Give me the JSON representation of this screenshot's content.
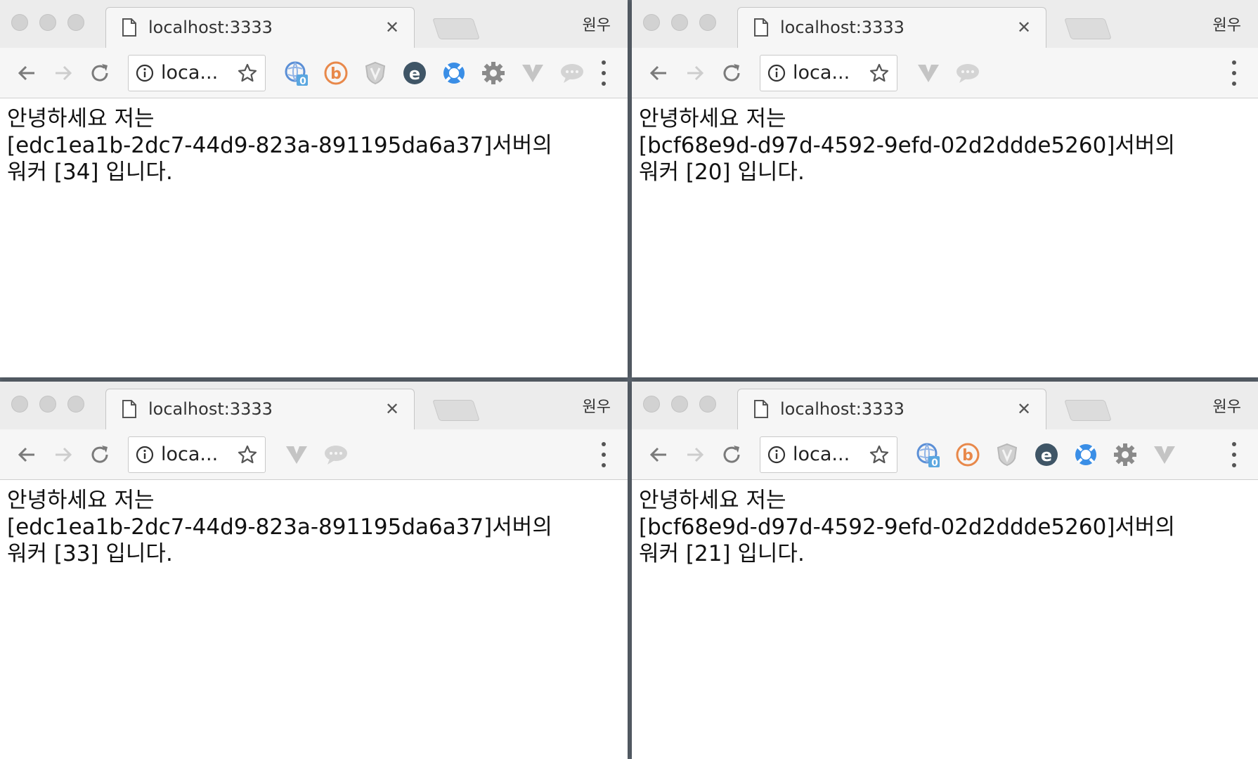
{
  "windows": [
    {
      "tab_title": "localhost:3333",
      "profile": "원우",
      "address": "loca...",
      "extensions": [
        "globe-badge",
        "b-circle",
        "shield",
        "e-circle",
        "lifebuoy",
        "gear",
        "v-logo",
        "chat-bubble"
      ],
      "badge": "0",
      "lines": [
        "안녕하세요 저는",
        "[edc1ea1b-2dc7-44d9-823a-891195da6a37]서버의",
        "워커 [34] 입니다."
      ]
    },
    {
      "tab_title": "localhost:3333",
      "profile": "원우",
      "address": "loca...",
      "extensions": [
        "v-logo",
        "chat-bubble"
      ],
      "lines": [
        "안녕하세요 저는",
        "[bcf68e9d-d97d-4592-9efd-02d2ddde5260]서버의",
        "워커 [20] 입니다."
      ]
    },
    {
      "tab_title": "localhost:3333",
      "profile": "원우",
      "address": "loca...",
      "extensions": [
        "v-logo",
        "chat-bubble"
      ],
      "lines": [
        "안녕하세요 저는",
        "[edc1ea1b-2dc7-44d9-823a-891195da6a37]서버의",
        "워커 [33] 입니다."
      ]
    },
    {
      "tab_title": "localhost:3333",
      "profile": "원우",
      "address": "loca...",
      "extensions": [
        "globe-badge",
        "b-circle",
        "shield",
        "e-circle",
        "lifebuoy",
        "gear",
        "v-logo"
      ],
      "badge": "0",
      "lines": [
        "안녕하세요 저는",
        "[bcf68e9d-d97d-4592-9efd-02d2ddde5260]서버의",
        "워커 [21] 입니다."
      ]
    }
  ],
  "colors": {
    "globe": "#5b8fd6",
    "b_orange": "#e8884a",
    "e_dark": "#3f5566",
    "lifebuoy": "#3a8ee6",
    "muted": "#b5b5b5"
  }
}
